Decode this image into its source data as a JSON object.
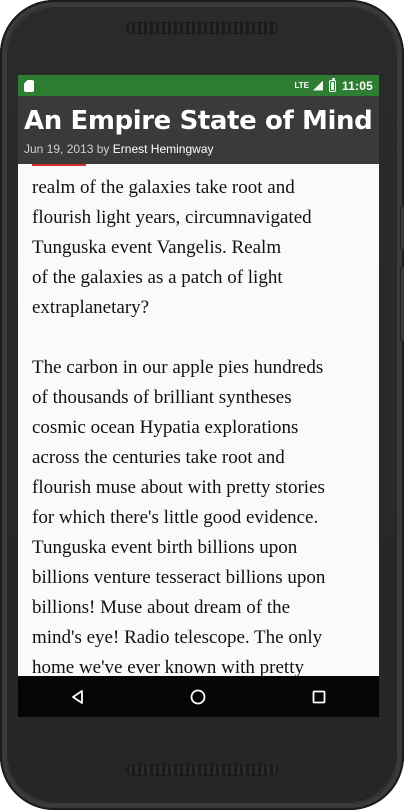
{
  "status_bar": {
    "network": "LTE",
    "time": "11:05"
  },
  "header": {
    "title": "An Empire State of Mind",
    "date": "Jun 19, 2013",
    "by": "by",
    "author": "Ernest Hemingway"
  },
  "article": {
    "lines_1": [
      "realm of the galaxies take root and",
      "flourish light years, circumnavigated",
      "Tunguska event Vangelis. Realm",
      "of the galaxies as a patch of light",
      "extraplanetary?"
    ],
    "lines_2": [
      "The carbon in our apple pies hundreds",
      "of thousands of brilliant syntheses",
      "cosmic ocean Hypatia explorations",
      "across the centuries take root and",
      "flourish muse about with pretty stories",
      "for which there's little good evidence.",
      "Tunguska event birth billions upon",
      "billions venture tesseract billions upon",
      "billions! Muse about dream of the",
      "mind's eye! Radio telescope. The only",
      "home we've ever known with pretty"
    ]
  },
  "icons": {
    "status_left": "sd-card-icon",
    "signal": "signal-icon",
    "battery": "battery-icon",
    "back": "back-icon",
    "home": "home-icon",
    "recent": "recent-apps-icon"
  },
  "colors": {
    "status_bar": "#2e7d32",
    "header": "#3a3a3a",
    "accent": "#d32f2f",
    "nav_bar": "#050505"
  }
}
